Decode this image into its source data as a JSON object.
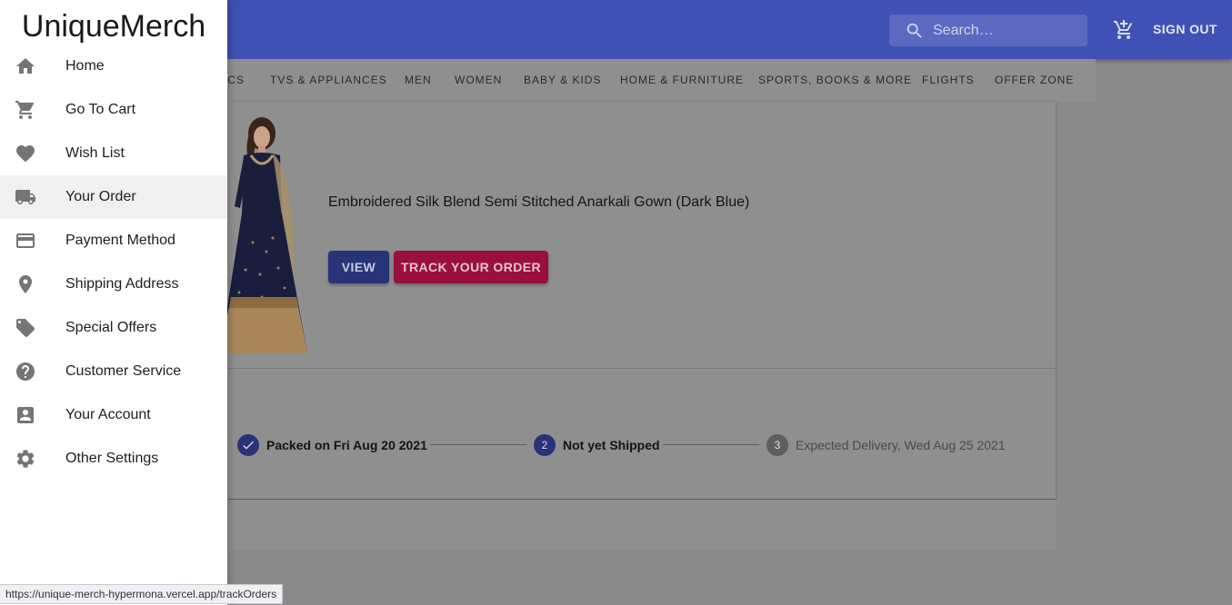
{
  "app": {
    "brand": "UniqueMerch"
  },
  "header": {
    "search": {
      "placeholder": "Search…",
      "icon": "search-icon"
    },
    "cart_icon": "add-shopping-cart-icon",
    "signout_label": "SIGN OUT"
  },
  "categories": [
    {
      "label": "ICS"
    },
    {
      "label": "TVS & APPLIANCES"
    },
    {
      "label": "MEN"
    },
    {
      "label": "WOMEN"
    },
    {
      "label": "BABY & KIDS"
    },
    {
      "label": "HOME & FURNITURE"
    },
    {
      "label": "SPORTS, BOOKS & MORE"
    },
    {
      "label": "FLIGHTS"
    },
    {
      "label": "OFFER ZONE"
    }
  ],
  "drawer": {
    "items": [
      {
        "label": "Home",
        "icon": "home-icon"
      },
      {
        "label": "Go To Cart",
        "icon": "cart-icon"
      },
      {
        "label": "Wish List",
        "icon": "heart-icon"
      },
      {
        "label": "Your Order",
        "icon": "truck-icon",
        "active": true
      },
      {
        "label": "Payment Method",
        "icon": "credit-card-icon"
      },
      {
        "label": "Shipping Address",
        "icon": "location-pin-icon"
      },
      {
        "label": "Special Offers",
        "icon": "tag-icon"
      },
      {
        "label": "Customer Service",
        "icon": "help-icon"
      },
      {
        "label": "Your Account",
        "icon": "account-box-icon"
      },
      {
        "label": "Other Settings",
        "icon": "gear-icon"
      }
    ]
  },
  "order": {
    "product_title": "Embroidered Silk Blend Semi Stitched Anarkali Gown (Dark Blue)",
    "view_label": "VIEW",
    "track_label": "TRACK YOUR ORDER",
    "steps": [
      {
        "label": "Packed on Fri Aug 20 2021",
        "state": "completed"
      },
      {
        "number": "2",
        "label": "Not yet Shipped",
        "state": "active"
      },
      {
        "number": "3",
        "label": "Expected Delivery, Wed Aug 25 2021",
        "state": "pending"
      }
    ]
  },
  "status_url": "https://unique-merch-hypermona.vercel.app/trackOrders",
  "colors": {
    "primary": "#3f51b5",
    "secondary": "#c2185b"
  }
}
